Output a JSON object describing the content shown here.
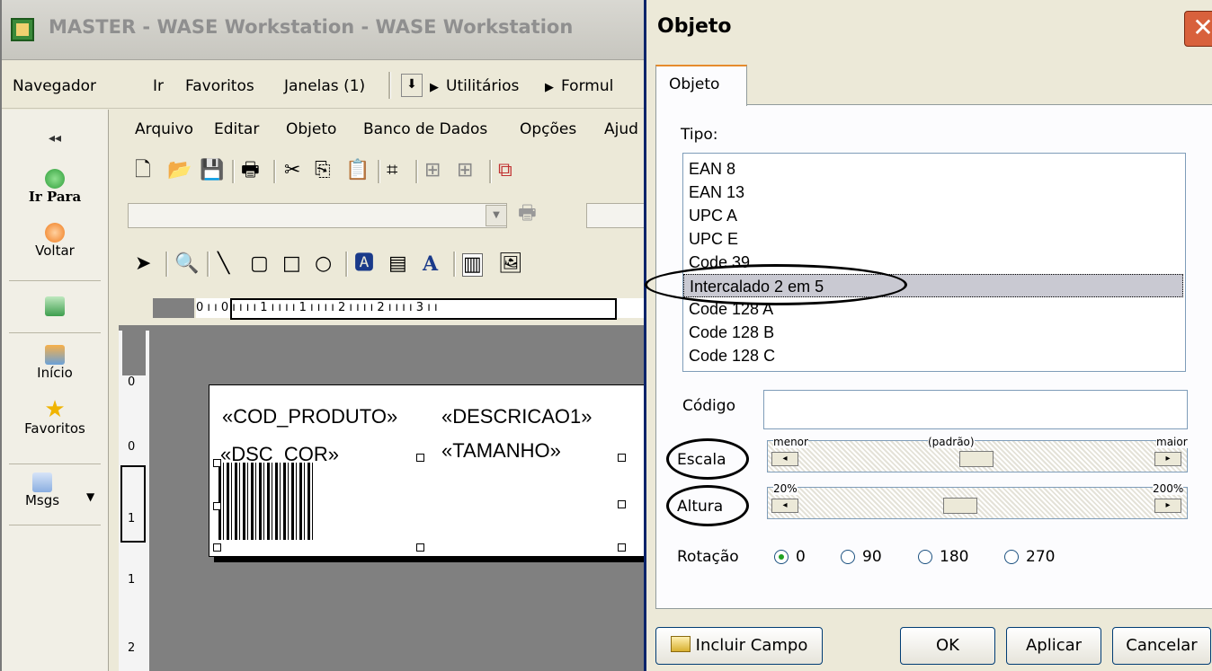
{
  "main_window": {
    "title": "MASTER - WASE Workstation - WASE Workstation",
    "menu1": [
      "Navegador",
      "Ir",
      "Favoritos",
      "Janelas (1)",
      "Utilitários",
      "Formul"
    ],
    "menu2": [
      "Arquivo",
      "Editar",
      "Objeto",
      "Banco de Dados",
      "Opções",
      "Ajud"
    ],
    "sidebar": {
      "collapse": "◂◂",
      "go_to": "Ir Para",
      "back": "Voltar",
      "home": "Início",
      "favorites": "Favoritos",
      "messages": "Msgs"
    },
    "ruler_h": "0 ı ı 0 ı ı ı ı 1 ı ı ı ı 1 ı ı ı ı 2 ı ı ı ı 2 ı ı ı ı 3 ı ı",
    "ruler_v": [
      "0",
      "0",
      "1",
      "1",
      "2"
    ],
    "label_fields": [
      "«COD_PRODUTO»",
      "«DESCRICAO1»",
      "«DSC_COR»",
      "«TAMANHO»"
    ]
  },
  "dialog": {
    "title": "Objeto",
    "close": "✕",
    "tab": "Objeto",
    "type_label": "Tipo:",
    "types": [
      "EAN 8",
      "EAN 13",
      "UPC A",
      "UPC E",
      "Code 39",
      "Intercalado 2 em 5",
      "Code 128 A",
      "Code 128 B",
      "Code 128 C"
    ],
    "selected_type": "Intercalado 2 em 5",
    "code_label": "Código",
    "code_value": "",
    "scale_label": "Escala",
    "scale_min": "menor",
    "scale_mid": "(padrão)",
    "scale_max": "maior",
    "scale_level": 0.5,
    "height_label": "Altura",
    "height_min": "20%",
    "height_max": "200%",
    "height_level": 0.45,
    "rotation_label": "Rotação",
    "rotations": [
      "0",
      "90",
      "180",
      "270"
    ],
    "rotation_selected": "0",
    "buttons": {
      "include_field": "Incluir Campo",
      "ok": "OK",
      "apply": "Aplicar",
      "cancel": "Cancelar"
    }
  }
}
